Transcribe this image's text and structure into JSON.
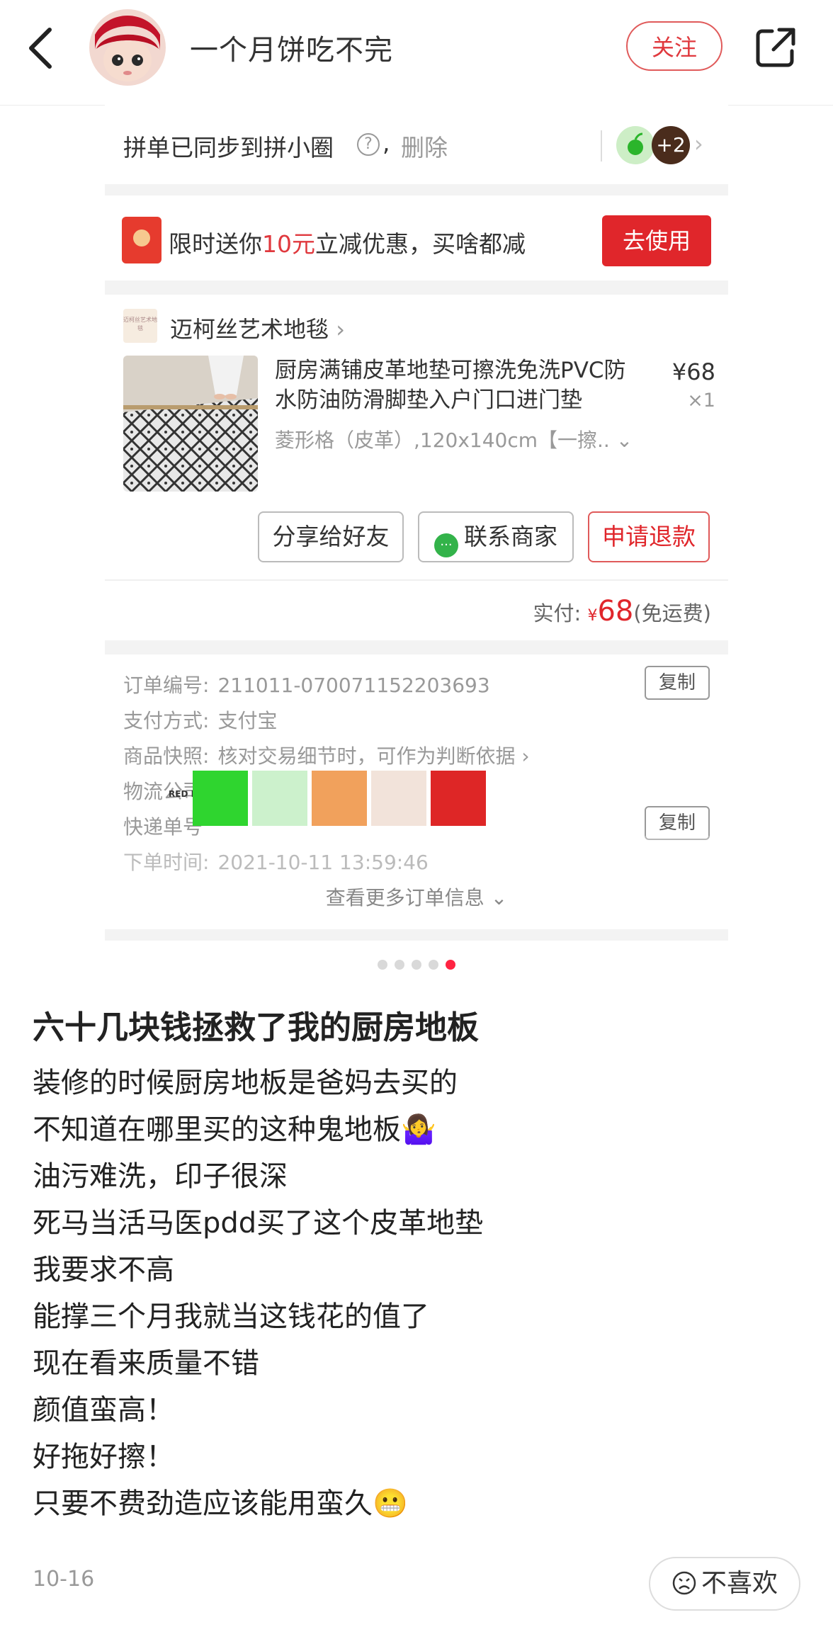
{
  "header": {
    "author_name": "一个月饼吃不完",
    "follow_label": "关注"
  },
  "sync": {
    "text": "拼单已同步到拼小圈",
    "help_glyph": "?",
    "comma": ",",
    "delete_label": "删除",
    "more_count": "+2"
  },
  "coupon": {
    "prefix": "限时送你",
    "amount": "10元",
    "suffix": "立减优惠，买啥都减",
    "button_label": "去使用"
  },
  "product": {
    "shop_name": "迈柯丝艺术地毯",
    "shop_logo_text": "迈柯丝艺术地毯",
    "title": "厨房满铺皮革地垫可擦洗免洗PVC防水防油防滑脚垫入户门口进门垫",
    "price": "¥68",
    "quantity": "×1",
    "spec": "菱形格（皮革）,120x140cm【一擦..",
    "share_label": "分享给好友",
    "contact_label": "联系商家",
    "refund_label": "申请退款",
    "paid_label": "实付:",
    "paid_currency": "¥",
    "paid_amount": "68",
    "paid_note": "(免运费)"
  },
  "order": {
    "number_label": "订单编号:",
    "number_value": "211011-070071152203693",
    "payment_label": "支付方式:",
    "payment_value": "支付宝",
    "snapshot_label": "商品快照:",
    "snapshot_value": "核对交易细节时，可作为判断依据",
    "logistics_label": "物流公司",
    "tracking_label": "快递单号",
    "time_label": "下单时间:",
    "time_value": "2021-10-11 13:59:46",
    "copy_label": "复制",
    "more_label": "查看更多订单信息",
    "watermark_text": "RED DESIGN",
    "swatch_colors": [
      "#2fd52f",
      "#ccf1cc",
      "#f1a15c",
      "#f2e3da",
      "#de2626"
    ]
  },
  "carousel": {
    "total": 5,
    "active_index": 5
  },
  "post": {
    "title": "六十几块钱拯救了我的厨房地板",
    "lines": [
      "装修的时候厨房地板是爸妈去买的",
      "不知道在哪里买的这种鬼地板🤷‍♀️",
      "油污难洗，印子很深",
      "死马当活马医pdd买了这个皮革地垫",
      "我要求不高",
      "能撑三个月我就当这钱花的值了",
      "现在看来质量不错",
      "颜值蛮高！",
      "好拖好擦！",
      "只要不费劲造应该能用蛮久😬"
    ],
    "date": "10-16",
    "dislike_label": "不喜欢"
  },
  "colors": {
    "brand_red": "#ff2442",
    "button_red": "#e0262b"
  }
}
